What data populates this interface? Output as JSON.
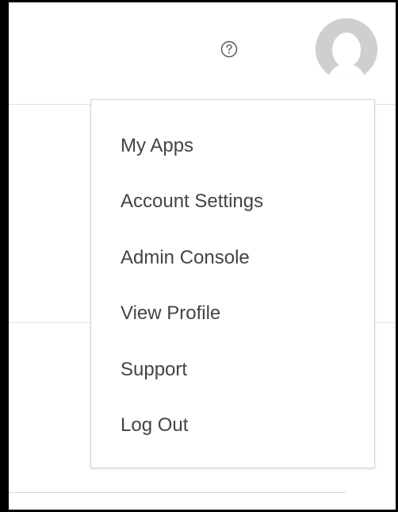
{
  "header": {
    "help_icon": "question-circle-icon",
    "avatar_icon": "user-silhouette-icon"
  },
  "menu": {
    "items": [
      {
        "label": "My Apps"
      },
      {
        "label": "Account Settings"
      },
      {
        "label": "Admin Console"
      },
      {
        "label": "View Profile"
      },
      {
        "label": "Support"
      },
      {
        "label": "Log Out"
      }
    ]
  },
  "colors": {
    "menu_text": "#444444",
    "avatar_bg": "#cfcfcf",
    "border": "#d5d5d5"
  }
}
